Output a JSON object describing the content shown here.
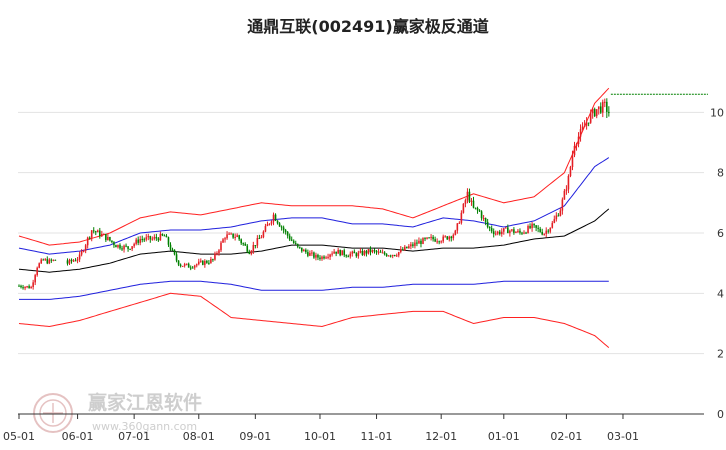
{
  "chart_data": {
    "type": "candlestick",
    "title": "通鼎互联(002491)赢家极反通道",
    "x_tick_labels": [
      "05-01",
      "06-01",
      "07-01",
      "08-01",
      "09-01",
      "10-01",
      "11-01",
      "12-01",
      "01-01",
      "02-01",
      "03-01"
    ],
    "y_tick_labels": [
      "0",
      "2",
      "4",
      "6",
      "8",
      "10"
    ],
    "ylim": [
      0,
      11
    ],
    "grid": "horizontal",
    "watermark": {
      "text": "赢家江恩软件",
      "url": "www.360gann.com"
    },
    "colors": {
      "up": "#e31e24",
      "down": "#008000",
      "outer_band": "#ff2020",
      "mid_band": "#1f1fdd",
      "center_line": "#000000",
      "last_price_line": "#008000",
      "grid": "#e3e3e3",
      "axis": "#333333"
    },
    "month_ticks_day": [
      0,
      29,
      57,
      89,
      117,
      149,
      177,
      209,
      240,
      271,
      299
    ],
    "channel": {
      "day": [
        0,
        15,
        30,
        45,
        60,
        75,
        90,
        105,
        120,
        135,
        150,
        165,
        180,
        195,
        210,
        225,
        240,
        255,
        270,
        285,
        292
      ],
      "upper_outer": [
        5.9,
        5.6,
        5.7,
        6.0,
        6.5,
        6.7,
        6.6,
        6.8,
        7.0,
        6.9,
        6.9,
        6.9,
        6.8,
        6.5,
        6.9,
        7.3,
        7.0,
        7.2,
        8.0,
        10.3,
        10.8
      ],
      "upper_mid": [
        5.5,
        5.3,
        5.4,
        5.6,
        6.0,
        6.1,
        6.1,
        6.2,
        6.4,
        6.5,
        6.5,
        6.3,
        6.3,
        6.2,
        6.5,
        6.4,
        6.2,
        6.4,
        6.9,
        8.2,
        8.5
      ],
      "center": [
        4.8,
        4.7,
        4.8,
        5.0,
        5.3,
        5.4,
        5.3,
        5.3,
        5.4,
        5.6,
        5.6,
        5.5,
        5.5,
        5.4,
        5.5,
        5.5,
        5.6,
        5.8,
        5.9,
        6.4,
        6.8
      ],
      "lower_mid": [
        3.8,
        3.8,
        3.9,
        4.1,
        4.3,
        4.4,
        4.4,
        4.3,
        4.1,
        4.1,
        4.1,
        4.2,
        4.2,
        4.3,
        4.3,
        4.3,
        4.4,
        4.4,
        4.4,
        4.4,
        4.4
      ],
      "lower_outer": [
        3.0,
        2.9,
        3.1,
        3.4,
        3.7,
        4.0,
        3.9,
        3.2,
        3.1,
        3.0,
        2.9,
        3.2,
        3.3,
        3.4,
        3.4,
        3.0,
        3.2,
        3.2,
        3.0,
        2.6,
        2.2
      ]
    },
    "price": {
      "day": [
        0,
        6,
        9,
        12,
        15,
        18,
        24,
        30,
        36,
        42,
        48,
        54,
        60,
        66,
        72,
        78,
        80,
        84,
        90,
        96,
        102,
        108,
        110,
        114,
        120,
        126,
        132,
        138,
        144,
        147,
        150,
        156,
        162,
        168,
        174,
        180,
        186,
        192,
        198,
        204,
        210,
        216,
        222,
        225,
        228,
        232,
        236,
        242,
        248,
        254,
        260,
        264,
        268,
        272,
        275,
        278,
        282,
        286,
        290,
        292
      ],
      "close": [
        4.25,
        4.2,
        4.9,
        5.1,
        5.05,
        5.1,
        5.0,
        5.2,
        6.1,
        5.9,
        5.6,
        5.5,
        5.8,
        5.8,
        5.9,
        5.1,
        4.95,
        4.9,
        5.0,
        5.1,
        5.9,
        5.9,
        5.7,
        5.4,
        5.9,
        6.6,
        6.0,
        5.5,
        5.3,
        5.2,
        5.2,
        5.4,
        5.3,
        5.3,
        5.4,
        5.3,
        5.3,
        5.5,
        5.7,
        5.8,
        5.8,
        6.0,
        7.3,
        6.8,
        6.7,
        6.2,
        6.0,
        6.1,
        6.0,
        6.2,
        6.0,
        6.3,
        6.8,
        7.8,
        9.0,
        9.3,
        9.8,
        10.1,
        10.2,
        10.0
      ]
    },
    "last_price": 10.6,
    "last_price_from_day": 293
  }
}
